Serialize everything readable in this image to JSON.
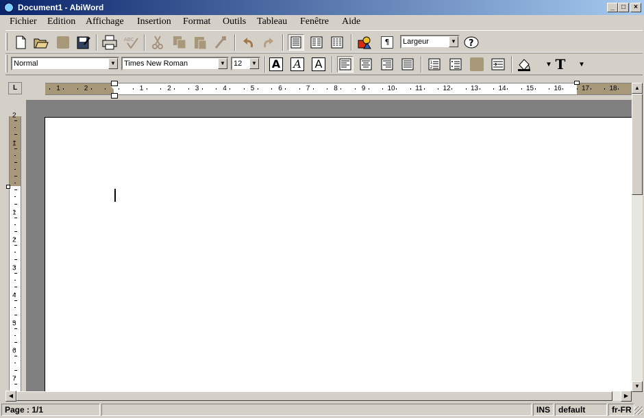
{
  "window": {
    "title": "Document1 - AbiWord",
    "controls": [
      "minimize",
      "maximize",
      "close"
    ]
  },
  "menu": [
    "Fichier",
    "Edition",
    "Affichage",
    "Insertion",
    "Format",
    "Outils",
    "Tableau",
    "Fenêtre",
    "Aide"
  ],
  "toolbar1": {
    "zoom_value": "Largeur",
    "icons": [
      "new-document-icon",
      "open-icon",
      "save-icon",
      "save-as-icon",
      "print-icon",
      "spellcheck-icon",
      "cut-icon",
      "copy-icon",
      "paste-icon",
      "format-painter-icon",
      "undo-icon",
      "redo-icon",
      "one-column-icon",
      "two-columns-icon",
      "three-columns-icon",
      "insert-image-icon",
      "pilcrow-icon",
      "help-icon"
    ]
  },
  "toolbar2": {
    "style_value": "Normal",
    "font_value": "Times New Roman",
    "size_value": "12",
    "bold_label": "A",
    "italic_label": "A",
    "underline_label": "A",
    "text_color_label": "T"
  },
  "ruler": {
    "corner_label": "L",
    "h_left_labels": [
      "2",
      "1"
    ],
    "h_labels": [
      "1",
      "2",
      "3",
      "4",
      "5",
      "6",
      "7",
      "8",
      "9",
      "10",
      "11",
      "12",
      "13",
      "14",
      "15",
      "16"
    ],
    "h_right_labels": [
      "17",
      "18"
    ],
    "v_top_labels": [
      "2",
      "1"
    ],
    "v_labels": [
      "1",
      "2",
      "3",
      "4",
      "5",
      "6",
      "7"
    ]
  },
  "status": {
    "page": "Page : 1/1",
    "mode": "INS",
    "style": "default",
    "lang": "fr-FR"
  },
  "colors": {
    "margin_tan": "#a8987a",
    "desk_gray": "#808080",
    "chrome": "#d4d0c8"
  }
}
